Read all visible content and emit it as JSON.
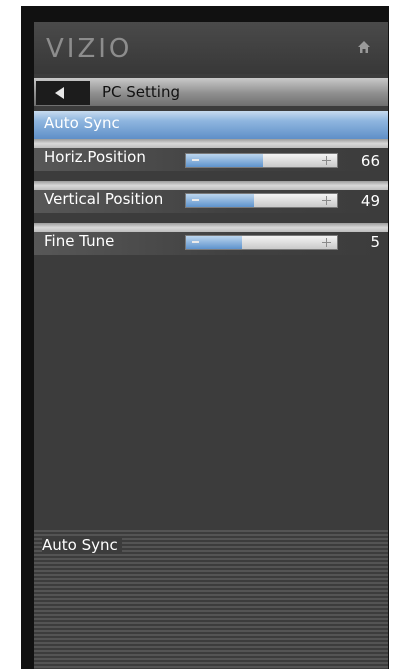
{
  "header": {
    "logo_text": "VIZIO",
    "home_icon": "home-icon"
  },
  "titlebar": {
    "back_icon": "left-arrow-icon",
    "title": "PC Setting"
  },
  "menu": {
    "items": [
      {
        "label": "Auto Sync",
        "selected": true
      },
      {
        "label": "Horiz.Position",
        "value": "66",
        "level_fraction": 0.51
      },
      {
        "label": "Vertical Position",
        "value": "49",
        "level_fraction": 0.45
      },
      {
        "label": "Fine Tune",
        "value": "5",
        "level_fraction": 0.37
      }
    ]
  },
  "description": {
    "text": "Auto Sync"
  },
  "colors": {
    "highlight": "#5f8fc8",
    "slider_fill": "#5e93cc",
    "panel_bg": "#3c3c3c"
  }
}
